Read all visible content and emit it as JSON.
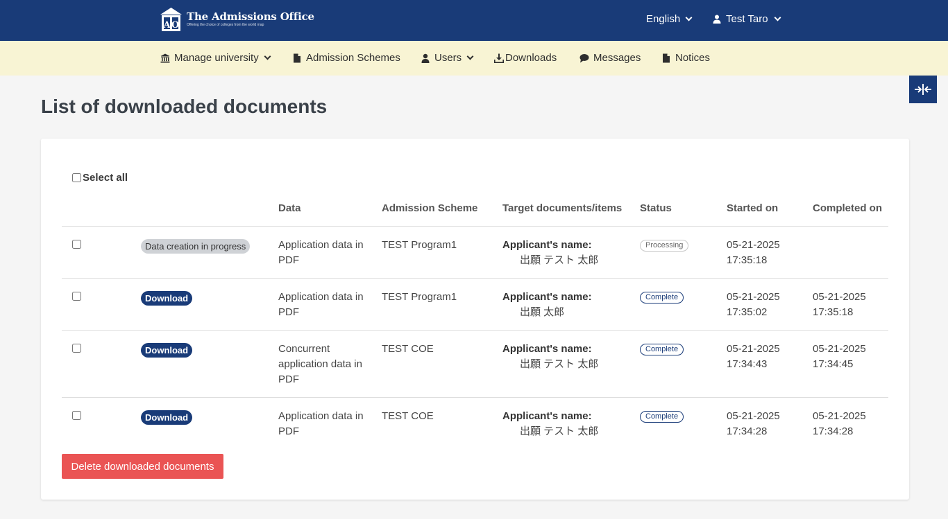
{
  "header": {
    "logo_title": "The Admissions Office",
    "logo_subtitle": "Offering the choice of colleges from the world map",
    "language": "English",
    "user_name": "Test Taro"
  },
  "nav": {
    "items": [
      {
        "label": "Manage university",
        "icon": "university-icon",
        "dropdown": true
      },
      {
        "label": "Admission Schemes",
        "icon": "document-icon",
        "dropdown": false
      },
      {
        "label": "Users",
        "icon": "user-icon",
        "dropdown": true
      },
      {
        "label": "Downloads",
        "icon": "download-icon",
        "dropdown": false
      },
      {
        "label": "Messages",
        "icon": "chat-bubble-icon",
        "dropdown": false
      },
      {
        "label": "Notices",
        "icon": "document-icon",
        "dropdown": false
      }
    ]
  },
  "page": {
    "title": "List of downloaded documents",
    "select_all": "Select all",
    "delete_button": "Delete downloaded documents"
  },
  "table": {
    "headers": {
      "data": "Data",
      "scheme": "Admission Scheme",
      "target": "Target documents/items",
      "status": "Status",
      "started": "Started on",
      "completed": "Completed on"
    },
    "rows": [
      {
        "action": "Data creation in progress",
        "data_line1": "Application data in",
        "data_line2": "PDF",
        "data_line3": "",
        "scheme": "TEST Program1",
        "target_label": "Applicant's name:",
        "target_name": "出願 テスト 太郎",
        "status": "Processing",
        "started_date": "05-21-2025",
        "started_time": "17:35:18",
        "completed_date": "",
        "completed_time": ""
      },
      {
        "action": "Download",
        "data_line1": "Application data in",
        "data_line2": "PDF",
        "data_line3": "",
        "scheme": "TEST Program1",
        "target_label": "Applicant's name:",
        "target_name": "出願 太郎",
        "status": "Complete",
        "started_date": "05-21-2025",
        "started_time": "17:35:02",
        "completed_date": "05-21-2025",
        "completed_time": "17:35:18"
      },
      {
        "action": "Download",
        "data_line1": "Concurrent",
        "data_line2": "application data in",
        "data_line3": "PDF",
        "scheme": "TEST COE",
        "target_label": "Applicant's name:",
        "target_name": "出願 テスト 太郎",
        "status": "Complete",
        "started_date": "05-21-2025",
        "started_time": "17:34:43",
        "completed_date": "05-21-2025",
        "completed_time": "17:34:45"
      },
      {
        "action": "Download",
        "data_line1": "Application data in",
        "data_line2": "PDF",
        "data_line3": "",
        "scheme": "TEST COE",
        "target_label": "Applicant's name:",
        "target_name": "出願 テスト 太郎",
        "status": "Complete",
        "started_date": "05-21-2025",
        "started_time": "17:34:28",
        "completed_date": "05-21-2025",
        "completed_time": "17:34:28"
      }
    ]
  },
  "colors": {
    "header_bg": "#193b78",
    "nav_bg": "#f8f4d4",
    "delete_button": "#ea5454"
  }
}
